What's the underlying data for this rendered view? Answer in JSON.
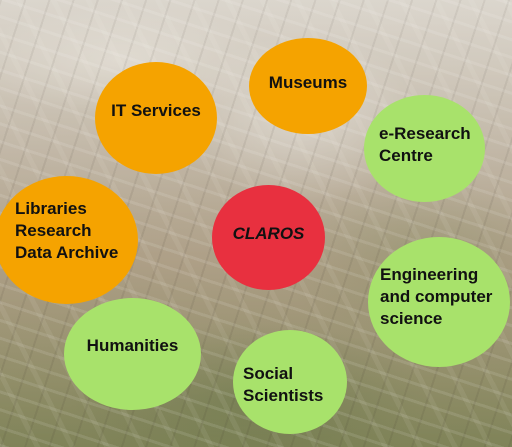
{
  "colors": {
    "museums_fill": "#F5A300",
    "it_services_fill": "#F5A300",
    "libraries_fill": "#F5A300",
    "eresearch_fill": "#A8E26B",
    "engineering_fill": "#A8E26B",
    "social_fill": "#A8E26B",
    "humanities_fill": "#A8E26B",
    "claros_fill": "#E8303F",
    "text": "#111111"
  },
  "nodes": {
    "museums": {
      "label": "Museums"
    },
    "it_services": {
      "label": "IT Services"
    },
    "eresearch": {
      "label": "e-Research\nCentre"
    },
    "libraries": {
      "label": "Libraries\nResearch\nData Archive"
    },
    "claros": {
      "label": "CLAROS"
    },
    "engineering": {
      "label": "Engineering\nand computer\nscience"
    },
    "humanities": {
      "label": "Humanities"
    },
    "social": {
      "label": "Social\nScientists"
    }
  }
}
